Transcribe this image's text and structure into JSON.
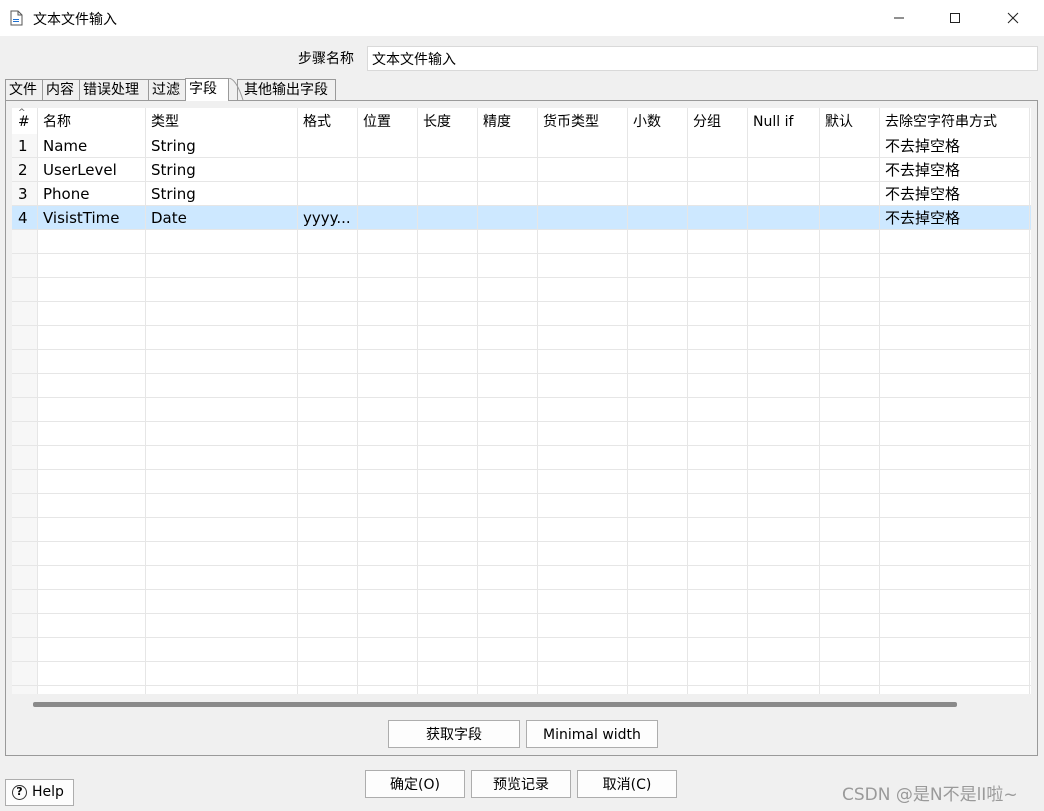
{
  "window": {
    "title": "文本文件输入"
  },
  "step": {
    "label": "步骤名称",
    "value": "文本文件输入"
  },
  "tabs": [
    {
      "label": "文件",
      "active": false
    },
    {
      "label": "内容",
      "active": false
    },
    {
      "label": "错误处理",
      "active": false
    },
    {
      "label": "过滤",
      "active": false
    },
    {
      "label": "字段",
      "active": true
    },
    {
      "label": "其他输出字段",
      "active": false
    }
  ],
  "table": {
    "columns": [
      "#",
      "名称",
      "类型",
      "格式",
      "位置",
      "长度",
      "精度",
      "货币类型",
      "小数",
      "分组",
      "Null if",
      "默认",
      "去除空字符串方式"
    ],
    "rows": [
      {
        "num": "1",
        "name": "Name",
        "type": "String",
        "format": "",
        "trim": "不去掉空格"
      },
      {
        "num": "2",
        "name": "UserLevel",
        "type": "String",
        "format": "",
        "trim": "不去掉空格"
      },
      {
        "num": "3",
        "name": "Phone",
        "type": "String",
        "format": "",
        "trim": "不去掉空格"
      },
      {
        "num": "4",
        "name": "VisistTime",
        "type": "Date",
        "format": "yyyy...",
        "trim": "不去掉空格"
      }
    ]
  },
  "buttons": {
    "get_fields": "获取字段",
    "minimal_width": "Minimal width",
    "ok": "确定(O)",
    "preview": "预览记录",
    "cancel": "取消(C)",
    "help": "Help"
  },
  "watermark": "CSDN @是N不是lI啦~",
  "colors": {
    "selected_row": "#cde8ff",
    "grid_line": "#e6e6e6"
  }
}
